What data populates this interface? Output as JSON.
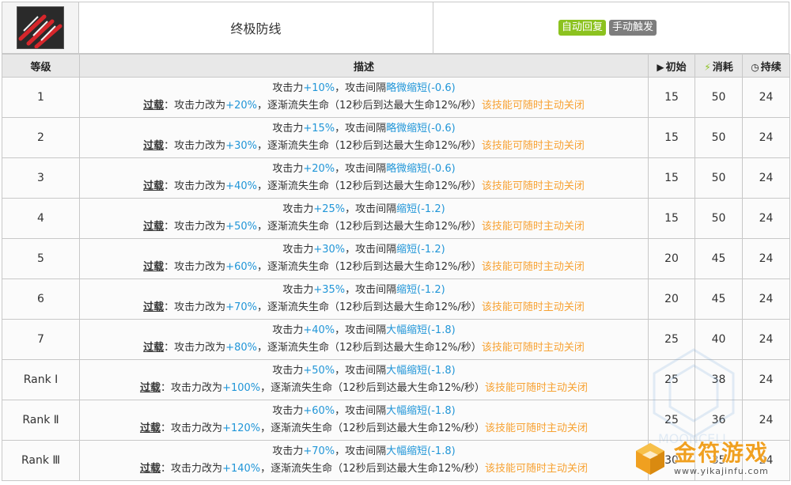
{
  "skill": {
    "name": "终极防线",
    "tags": [
      "自动回复",
      "手动触发"
    ]
  },
  "headers": {
    "level": "等级",
    "desc": "描述",
    "initial": "初始",
    "cost": "消耗",
    "duration": "持续"
  },
  "rows": [
    {
      "level": "1",
      "atk": "+10%",
      "interval_prefix": "，攻击间隔",
      "interval": "略微缩短(-0.6)",
      "atk2": "+20%",
      "initial": "15",
      "cost": "50",
      "duration": "24"
    },
    {
      "level": "2",
      "atk": "+15%",
      "interval_prefix": "，攻击间隔",
      "interval": "略微缩短(-0.6)",
      "atk2": "+30%",
      "initial": "15",
      "cost": "50",
      "duration": "24"
    },
    {
      "level": "3",
      "atk": "+20%",
      "interval_prefix": "，攻击间隔",
      "interval": "略微缩短(-0.6)",
      "atk2": "+40%",
      "initial": "15",
      "cost": "50",
      "duration": "24"
    },
    {
      "level": "4",
      "atk": "+25%",
      "interval_prefix": "，攻击间隔",
      "interval": "缩短(-1.2)",
      "atk2": "+50%",
      "initial": "15",
      "cost": "50",
      "duration": "24"
    },
    {
      "level": "5",
      "atk": "+30%",
      "interval_prefix": "，攻击间隔",
      "interval": "缩短(-1.2)",
      "atk2": "+60%",
      "initial": "20",
      "cost": "45",
      "duration": "24"
    },
    {
      "level": "6",
      "atk": "+35%",
      "interval_prefix": "，攻击间隔",
      "interval": "缩短(-1.2)",
      "atk2": "+70%",
      "initial": "20",
      "cost": "45",
      "duration": "24"
    },
    {
      "level": "7",
      "atk": "+40%",
      "interval_prefix": "，攻击间隔",
      "interval": "大幅缩短(-1.8)",
      "atk2": "+80%",
      "initial": "25",
      "cost": "40",
      "duration": "24"
    },
    {
      "level": "Rank Ⅰ",
      "atk": "+50%",
      "interval_prefix": "，攻击间隔",
      "interval": "大幅缩短(-1.8)",
      "atk2": "+100%",
      "initial": "25",
      "cost": "38",
      "duration": "24"
    },
    {
      "level": "Rank Ⅱ",
      "atk": "+60%",
      "interval_prefix": "，攻击间隔",
      "interval": "大幅缩短(-1.8)",
      "atk2": "+120%",
      "initial": "25",
      "cost": "36",
      "duration": "24"
    },
    {
      "level": "Rank Ⅲ",
      "atk": "+70%",
      "interval_prefix": "，攻击间隔",
      "interval": "大幅缩短(-1.8)",
      "atk2": "+140%",
      "initial": "30",
      "cost": "35",
      "duration": "24"
    }
  ],
  "desc_text": {
    "atk_label": "攻击力",
    "overload": "过载",
    "line2_a": "：攻击力改为",
    "line2_b": "，逐渐流失生命（12秒后到达最大生命12%/秒）",
    "line2_c": "该技能可随时主动关闭"
  },
  "watermark": {
    "main": "金符游戏",
    "sub": "www.yikajinfu.com",
    "brand": "MOONCELL"
  },
  "colors": {
    "blue": "#2196d8",
    "orange": "#f7a233",
    "tag_green": "#8cc21f",
    "tag_gray": "#7d7d7d"
  }
}
